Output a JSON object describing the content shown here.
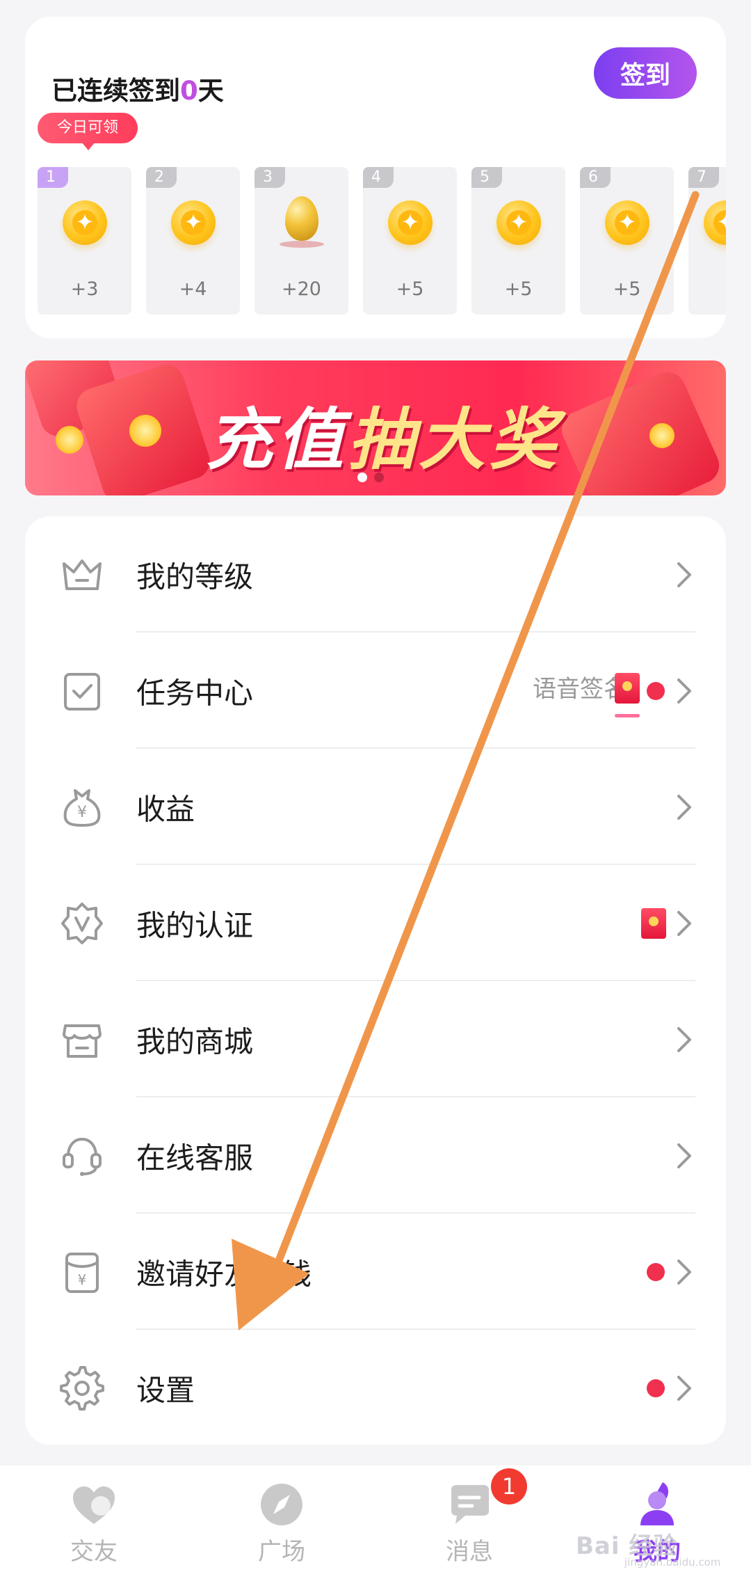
{
  "checkin": {
    "title_prefix": "已连续签到",
    "days": "0",
    "title_suffix": "天",
    "button_label": "签到",
    "today_tag": "今日可领",
    "days_list": [
      {
        "num": "1",
        "reward": "+3",
        "icon": "coin-icon"
      },
      {
        "num": "2",
        "reward": "+4",
        "icon": "coin-icon"
      },
      {
        "num": "3",
        "reward": "+20",
        "icon": "golden-egg-icon"
      },
      {
        "num": "4",
        "reward": "+5",
        "icon": "coin-icon"
      },
      {
        "num": "5",
        "reward": "+5",
        "icon": "coin-icon"
      },
      {
        "num": "6",
        "reward": "+5",
        "icon": "coin-icon"
      },
      {
        "num": "7",
        "reward": "",
        "icon": "coin-icon"
      }
    ]
  },
  "banner": {
    "text_main": "充值",
    "text_highlight": "抽大奖",
    "slides": 2,
    "active_slide": 1
  },
  "menu": {
    "items": [
      {
        "label": "我的等级",
        "icon": "crown-icon"
      },
      {
        "label": "任务中心",
        "icon": "task-check-icon",
        "hint": "语音签名"
      },
      {
        "label": "收益",
        "icon": "money-bag-icon"
      },
      {
        "label": "我的认证",
        "icon": "verify-badge-icon"
      },
      {
        "label": "我的商城",
        "icon": "shop-icon"
      },
      {
        "label": "在线客服",
        "icon": "headset-icon"
      },
      {
        "label": "邀请好友赚钱",
        "icon": "invite-envelope-icon"
      },
      {
        "label": "设置",
        "icon": "settings-gear-icon"
      }
    ]
  },
  "bottom_nav": {
    "items": [
      {
        "label": "交友",
        "icon": "heart-friends-icon"
      },
      {
        "label": "广场",
        "icon": "compass-icon"
      },
      {
        "label": "消息",
        "icon": "chat-bubble-icon",
        "badge": "1"
      },
      {
        "label": "我的",
        "icon": "profile-icon",
        "active": true
      }
    ]
  },
  "colors": {
    "accent": "#8c3ff2",
    "notify_red": "#f0304e",
    "banner_red": "#ff2952",
    "arrow": "#f0964a"
  },
  "watermark": {
    "text": "Bai 经验",
    "sub": "jingyan.baidu.com"
  }
}
